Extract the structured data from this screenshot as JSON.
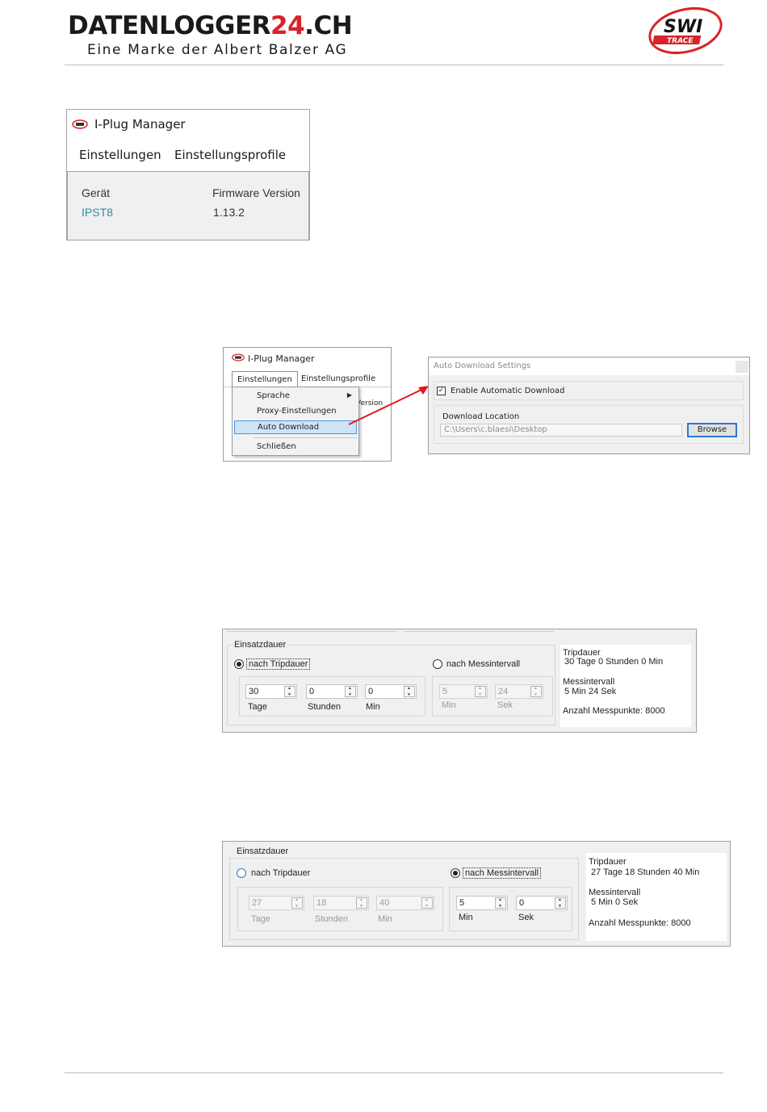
{
  "header": {
    "brand_main": "DATENLOGGER",
    "brand_accent": "24",
    "brand_suffix": ".CH",
    "tagline": "Eine Marke der Albert Balzer AG",
    "logo_text_1": "SWI",
    "logo_text_2": "TRACE",
    "accent_color": "#d9222a"
  },
  "shot1": {
    "title": "I-Plug Manager",
    "menu": [
      "Einstellungen",
      "Einstellungsprofile"
    ],
    "device_label": "Gerät",
    "firmware_label": "Firmware Version",
    "device_value": "IPST8",
    "firmware_value": "1.13.2"
  },
  "shot2": {
    "title": "I-Plug Manager",
    "menu": [
      "Einstellungen",
      "Einstellungsprofile"
    ],
    "behind_text": "Version",
    "items": [
      "Sprache",
      "Proxy-Einstellungen",
      "Auto Download",
      "Schließen"
    ],
    "selected_item": "Auto Download"
  },
  "shot3": {
    "title": "Auto Download Settings",
    "enable_label": "Enable Automatic Download",
    "enabled": true,
    "location_label": "Download Location",
    "location_value": "C:\\Users\\c.blaesi\\Desktop",
    "browse_label": "Browse"
  },
  "shot4": {
    "group_title": "Einsatzdauer",
    "radio_trip": "nach Tripdauer",
    "radio_interval": "nach Messintervall",
    "selected": "trip",
    "trip_fields": [
      {
        "value": "30",
        "label": "Tage"
      },
      {
        "value": "0",
        "label": "Stunden"
      },
      {
        "value": "0",
        "label": "Min"
      }
    ],
    "interval_fields": [
      {
        "value": "5",
        "label": "Min"
      },
      {
        "value": "24",
        "label": "Sek"
      }
    ],
    "info": {
      "trip_title": "Tripdauer",
      "trip_value": "30 Tage 0 Stunden 0 Min",
      "interval_title": "Messintervall",
      "interval_value": "5 Min 24 Sek",
      "points": "Anzahl Messpunkte: 8000"
    }
  },
  "shot5": {
    "group_title": "Einsatzdauer",
    "radio_trip": "nach Tripdauer",
    "radio_interval": "nach Messintervall",
    "selected": "interval",
    "trip_fields": [
      {
        "value": "27",
        "label": "Tage"
      },
      {
        "value": "18",
        "label": "Stunden"
      },
      {
        "value": "40",
        "label": "Min"
      }
    ],
    "interval_fields": [
      {
        "value": "5",
        "label": "Min"
      },
      {
        "value": "0",
        "label": "Sek"
      }
    ],
    "info": {
      "trip_title": "Tripdauer",
      "trip_value": "27 Tage 18 Stunden 40 Min",
      "interval_title": "Messintervall",
      "interval_value": "5 Min 0 Sek",
      "points": "Anzahl Messpunkte: 8000"
    }
  }
}
